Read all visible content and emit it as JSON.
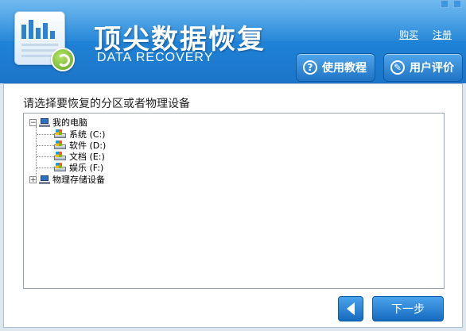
{
  "app": {
    "title_cn": "顶尖数据恢复",
    "title_en": "DATA RECOVERY"
  },
  "top_links": {
    "buy": "购买",
    "register": "注册"
  },
  "header_buttons": {
    "tutorial": "使用教程",
    "review": "用户评价"
  },
  "main": {
    "prompt": "请选择要恢复的分区或者物理设备"
  },
  "tree": {
    "computer": "我的电脑",
    "partitions": [
      {
        "label": "系统 (C:)"
      },
      {
        "label": "软件 (D:)"
      },
      {
        "label": "文档 (E:)"
      },
      {
        "label": "娱乐 (F:)"
      }
    ],
    "physical": "物理存储设备",
    "expanded_symbol": "−",
    "collapsed_symbol": "+"
  },
  "nav": {
    "next": "下一步"
  },
  "colors": {
    "header": "#1f84d8",
    "button": "#1f73c5",
    "panel": "#ffffff"
  }
}
